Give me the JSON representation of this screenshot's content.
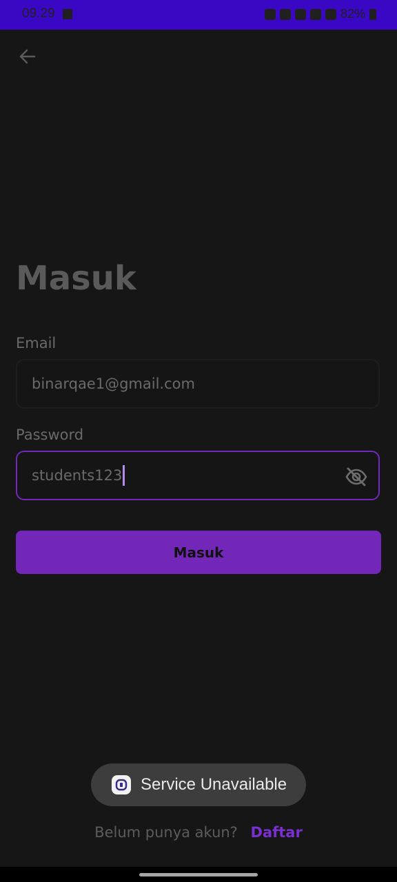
{
  "status_bar": {
    "time": "09.29",
    "battery": "82%"
  },
  "header": {
    "back_icon": "arrow-left-icon"
  },
  "main": {
    "title": "Masuk",
    "email": {
      "label": "Email",
      "value": "binarqae1@gmail.com"
    },
    "password": {
      "label": "Password",
      "value": "students123",
      "toggle_icon": "eye-off-icon"
    },
    "submit_label": "Masuk"
  },
  "toast": {
    "message": "Service Unavailable"
  },
  "footer": {
    "prompt": "Belum punya akun?",
    "link": "Daftar"
  },
  "colors": {
    "status_bar": "#3a07c4",
    "background": "#161616",
    "accent": "#7327b8",
    "focus_border": "#7227be"
  }
}
